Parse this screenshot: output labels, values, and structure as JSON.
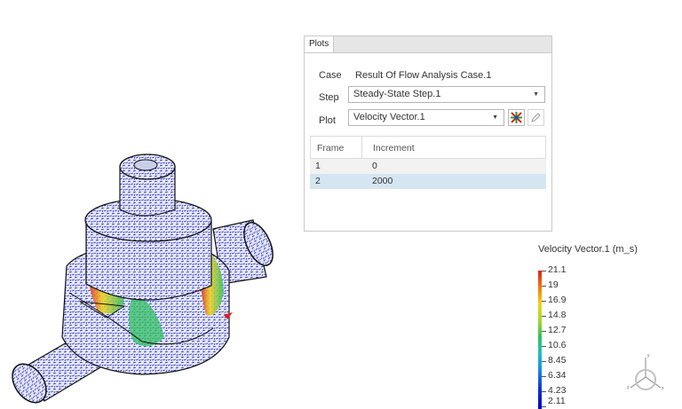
{
  "plots_panel": {
    "tab_label": "Plots",
    "case_label": "Case",
    "case_value": "Result Of Flow Analysis Case.1",
    "step_label": "Step",
    "step_value": "Steady-State Step.1",
    "plot_label": "Plot",
    "plot_value": "Velocity Vector.1",
    "frames": {
      "columns": [
        "Frame",
        "Increment"
      ],
      "rows": [
        {
          "frame": "1",
          "increment": "0"
        },
        {
          "frame": "2",
          "increment": "2000"
        }
      ],
      "selected_row": 1
    }
  },
  "legend": {
    "title": "Velocity Vector.1 (m_s)",
    "values": [
      "21.1",
      "19",
      "16.9",
      "14.8",
      "12.7",
      "10.6",
      "8.45",
      "6.34",
      "4.23",
      "2.11"
    ],
    "colors": [
      "#e0201a",
      "#f07a10",
      "#f2d21a",
      "#a8d830",
      "#30c060",
      "#20c0c0",
      "#1a8ce0",
      "#1030d0",
      "#0a00c0"
    ]
  },
  "triad": {
    "x": "x",
    "y": "y",
    "z": "z"
  },
  "icons": [
    "chevron-down-icon",
    "multi-plot-icon",
    "pencil-icon"
  ]
}
